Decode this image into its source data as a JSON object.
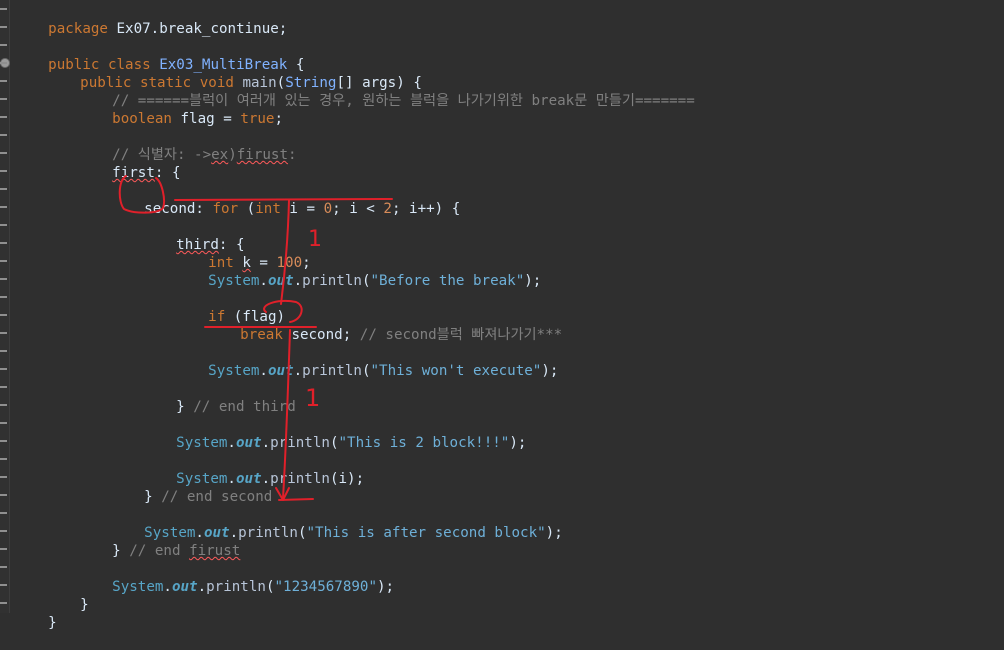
{
  "editor": {
    "lines": {
      "l1": {
        "kw": "package",
        "rest": " Ex07.break_continue;"
      },
      "l3": {
        "kw1": "public",
        "kw2": " class ",
        "cls": "Ex03_MultiBreak",
        "rest": " {"
      },
      "l4": {
        "kw1": "public static void ",
        "mth": "main",
        "p1": "(",
        "cls": "String",
        "p2": "[] ",
        "var": "args",
        "p3": ") {"
      },
      "l5": {
        "com": "// ======블럭이 여러개 있는 경우, 원하는 블럭을 나가기위한 break문 만들기======="
      },
      "l6": {
        "kw": "boolean ",
        "var": "flag",
        "p": " = ",
        "lit": "true",
        "end": ";"
      },
      "l8": {
        "com1": "// 식별자: ->",
        "com2": "ex",
        "com3": ")",
        "com4": "firust",
        "com5": ":"
      },
      "l9": {
        "lbl": "first",
        "rest": ": {"
      },
      "l11": {
        "lbl": "second",
        "p1": ": ",
        "kw": "for",
        "p2": " (",
        "kw2": "int",
        "v1": " i",
        "p3": " = ",
        "n1": "0",
        "p4": "; ",
        "v2": "i",
        "p5": " < ",
        "n2": "2",
        "p6": "; ",
        "v3": "i",
        "p7": "++) {"
      },
      "l13": {
        "lbl": "third",
        "rest": ": {"
      },
      "l14": {
        "kw": "int ",
        "var": "k",
        "p": " = ",
        "num": "100",
        "end": ";"
      },
      "l15": {
        "sys": "System",
        "d1": ".",
        "fld": "out",
        "d2": ".",
        "mth": "println",
        "p1": "(",
        "str": "\"Before the break\"",
        "p2": ");"
      },
      "l17": {
        "kw": "if",
        "rest": " (flag)"
      },
      "l18": {
        "kw": "break",
        "sp": " ",
        "lbl": "second",
        "p": ";",
        "com": " // second블럭 빠져나가기***"
      },
      "l20": {
        "sys": "System",
        "d1": ".",
        "fld": "out",
        "d2": ".",
        "mth": "println",
        "p1": "(",
        "str": "\"This won't execute\"",
        "p2": ");"
      },
      "l22": {
        "p": "} ",
        "com": "// end third"
      },
      "l24": {
        "sys": "System",
        "d1": ".",
        "fld": "out",
        "d2": ".",
        "mth": "println",
        "p1": "(",
        "str": "\"This is 2 block!!!\"",
        "p2": ");"
      },
      "l26": {
        "sys": "System",
        "d1": ".",
        "fld": "out",
        "d2": ".",
        "mth": "println",
        "p1": "(",
        "var": "i",
        "p2": ");"
      },
      "l27": {
        "p": "} ",
        "com": "// end second"
      },
      "l29": {
        "sys": "System",
        "d1": ".",
        "fld": "out",
        "d2": ".",
        "mth": "println",
        "p1": "(",
        "str": "\"This is after second block\"",
        "p2": ");"
      },
      "l30": {
        "p": "} ",
        "com1": "// end ",
        "com2": "firust"
      },
      "l32": {
        "sys": "System",
        "d1": ".",
        "fld": "out",
        "d2": ".",
        "mth": "println",
        "p1": "(",
        "str": "\"1234567890\"",
        "p2": ");"
      },
      "l33": {
        "p": "}"
      },
      "l34": {
        "p": "}"
      }
    }
  },
  "annotations": {
    "color": "#e0202a",
    "mark_top": "1",
    "mark_bottom": "1"
  }
}
